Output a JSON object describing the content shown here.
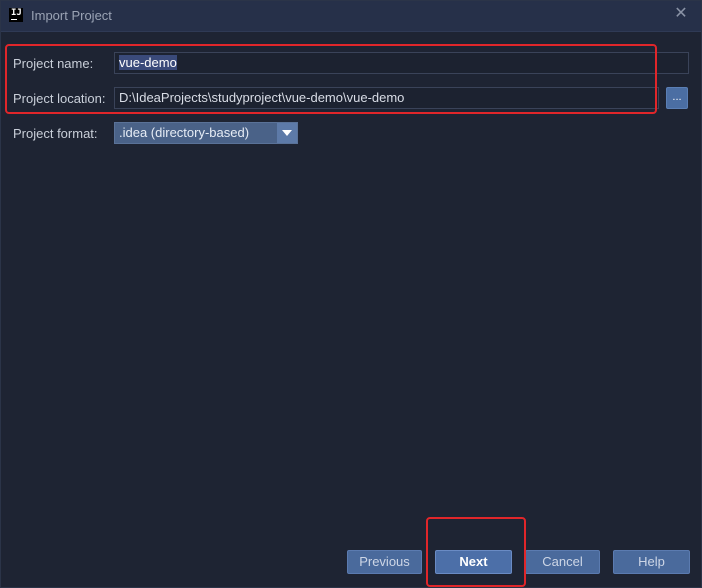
{
  "window": {
    "title": "Import Project",
    "close_icon": "close-icon"
  },
  "form": {
    "project_name_label": "Project name:",
    "project_name_value": "vue-demo",
    "project_location_label": "Project location:",
    "project_location_value": "D:\\IdeaProjects\\studyproject\\vue-demo\\vue-demo",
    "browse_label": "...",
    "project_format_label": "Project format:",
    "project_format_value": ".idea (directory-based)"
  },
  "buttons": {
    "previous": "Previous",
    "next": "Next",
    "cancel": "Cancel",
    "help": "Help"
  },
  "colors": {
    "background": "#1e2433",
    "titlebar": "#263049",
    "accent": "#4c6fa8",
    "highlight": "#e0262a"
  }
}
